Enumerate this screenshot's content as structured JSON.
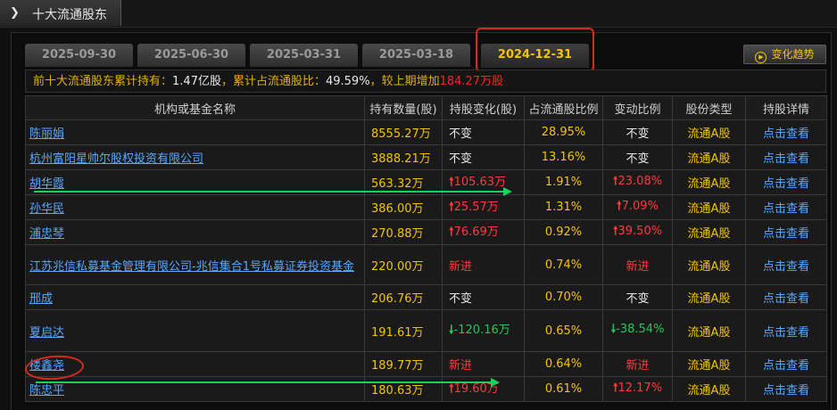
{
  "title": "十大流通股东",
  "tabs": [
    "2025-09-30",
    "2025-06-30",
    "2025-03-31",
    "2025-03-18",
    "2024-12-31"
  ],
  "active_tab": "2024-12-31",
  "trend_button": "变化趋势",
  "summary": {
    "label1": "前十大流通股东累计持有：",
    "total": "1.47亿股",
    "label2": "，累计占流通股比：",
    "ratio": "49.59%",
    "label3": "，较上期增加",
    "increase": "184.27万股"
  },
  "columns": [
    "机构或基金名称",
    "持有数量(股)",
    "持股变化(股)",
    "占流通股比例",
    "变动比例",
    "股份类型",
    "持股详情"
  ],
  "rows": [
    {
      "name": "陈丽娟",
      "shares": "8555.27万",
      "change": "不变",
      "change_dir": "none",
      "ratio": "28.95%",
      "pct": "不变",
      "pct_dir": "none",
      "type": "流通A股",
      "detail": "点击查看"
    },
    {
      "name": "杭州富阳星帅尔股权投资有限公司",
      "shares": "3888.21万",
      "change": "不变",
      "change_dir": "none",
      "ratio": "13.16%",
      "pct": "不变",
      "pct_dir": "none",
      "type": "流通A股",
      "detail": "点击查看"
    },
    {
      "name": "胡华霞",
      "shares": "563.32万",
      "change": "105.63万",
      "change_dir": "up",
      "ratio": "1.91%",
      "pct": "23.08%",
      "pct_dir": "up",
      "type": "流通A股",
      "detail": "点击查看"
    },
    {
      "name": "孙华民",
      "shares": "386.00万",
      "change": "25.57万",
      "change_dir": "up",
      "ratio": "1.31%",
      "pct": "7.09%",
      "pct_dir": "up",
      "type": "流通A股",
      "detail": "点击查看"
    },
    {
      "name": "浦忠琴",
      "shares": "270.88万",
      "change": "76.69万",
      "change_dir": "up",
      "ratio": "0.92%",
      "pct": "39.50%",
      "pct_dir": "up",
      "type": "流通A股",
      "detail": "点击查看"
    },
    {
      "name": "江苏兆信私募基金管理有限公司-兆信集合1号私募证券投资基金",
      "shares": "220.00万",
      "change": "新进",
      "change_dir": "new",
      "ratio": "0.74%",
      "pct": "新进",
      "pct_dir": "new",
      "type": "流通A股",
      "detail": "点击查看"
    },
    {
      "name": "邢成",
      "shares": "206.76万",
      "change": "不变",
      "change_dir": "none",
      "ratio": "0.70%",
      "pct": "不变",
      "pct_dir": "none",
      "type": "流通A股",
      "detail": "点击查看"
    },
    {
      "name": "夏启达",
      "shares": "191.61万",
      "change": "-120.16万",
      "change_dir": "down",
      "ratio": "0.65%",
      "pct": "-38.54%",
      "pct_dir": "down",
      "type": "流通A股",
      "detail": "点击查看"
    },
    {
      "name": "楼鑫尧",
      "shares": "189.77万",
      "change": "新进",
      "change_dir": "new",
      "ratio": "0.64%",
      "pct": "新进",
      "pct_dir": "new",
      "type": "流通A股",
      "detail": "点击查看"
    },
    {
      "name": "陈忠平",
      "shares": "180.63万",
      "change": "19.60万",
      "change_dir": "up",
      "ratio": "0.61%",
      "pct": "12.17%",
      "pct_dir": "up",
      "type": "流通A股",
      "detail": "点击查看"
    }
  ]
}
